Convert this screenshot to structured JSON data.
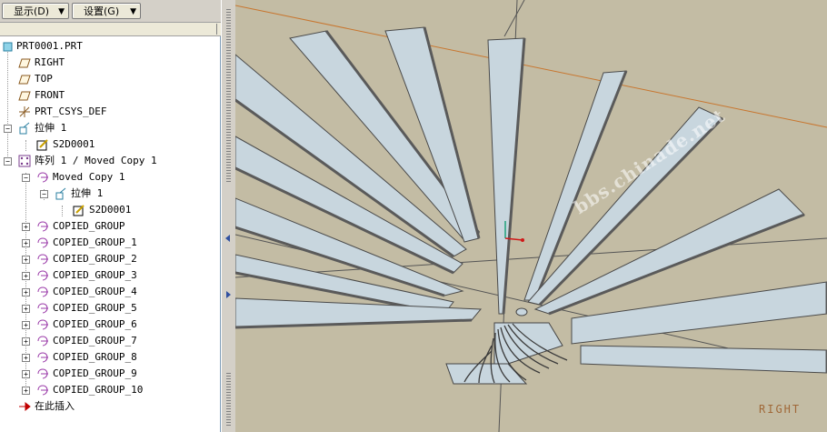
{
  "toolbar": {
    "display_label": "显示(D)",
    "settings_label": "设置(G)"
  },
  "tree": {
    "root": "PRT0001.PRT",
    "items": [
      {
        "label": "RIGHT",
        "icon": "datum-plane-icon"
      },
      {
        "label": "TOP",
        "icon": "datum-plane-icon"
      },
      {
        "label": "FRONT",
        "icon": "datum-plane-icon"
      },
      {
        "label": "PRT_CSYS_DEF",
        "icon": "csys-icon"
      },
      {
        "label": "拉伸 1",
        "icon": "extrude-icon"
      },
      {
        "label": "S2D0001",
        "icon": "sketch-icon"
      },
      {
        "label": "阵列 1 / Moved Copy 1",
        "icon": "pattern-icon"
      },
      {
        "label": "Moved Copy 1",
        "icon": "group-icon"
      },
      {
        "label": "拉伸 1",
        "icon": "extrude-icon"
      },
      {
        "label": "S2D0001",
        "icon": "sketch-icon"
      },
      {
        "label": "COPIED_GROUP",
        "icon": "group-icon"
      },
      {
        "label": "COPIED_GROUP_1",
        "icon": "group-icon"
      },
      {
        "label": "COPIED_GROUP_2",
        "icon": "group-icon"
      },
      {
        "label": "COPIED_GROUP_3",
        "icon": "group-icon"
      },
      {
        "label": "COPIED_GROUP_4",
        "icon": "group-icon"
      },
      {
        "label": "COPIED_GROUP_5",
        "icon": "group-icon"
      },
      {
        "label": "COPIED_GROUP_6",
        "icon": "group-icon"
      },
      {
        "label": "COPIED_GROUP_7",
        "icon": "group-icon"
      },
      {
        "label": "COPIED_GROUP_8",
        "icon": "group-icon"
      },
      {
        "label": "COPIED_GROUP_9",
        "icon": "group-icon"
      },
      {
        "label": "COPIED_GROUP_10",
        "icon": "group-icon"
      },
      {
        "label": "在此插入",
        "icon": "insert-here-arrow-icon"
      }
    ]
  },
  "viewport": {
    "watermark": "bbs.chinade.net",
    "datum_label": "RIGHT",
    "colors": {
      "background": "#c3bca4",
      "blade_fill": "#c8d6de",
      "blade_edge": "#4a4a4a",
      "datum_orange": "#c8762f"
    }
  }
}
